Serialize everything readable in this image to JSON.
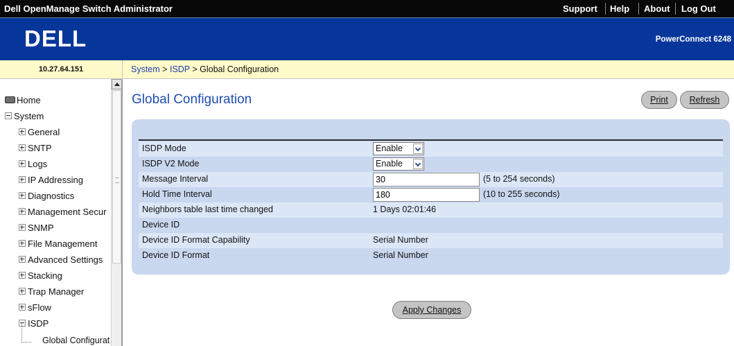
{
  "header": {
    "app_title": "Dell OpenManage Switch Administrator",
    "links": [
      "Support",
      "Help",
      "About",
      "Log Out"
    ],
    "logo_text": "DELL",
    "product": "PowerConnect 6248"
  },
  "ip_address": "10.27.64.151",
  "breadcrumb": {
    "system": "System",
    "sep1": " > ",
    "isdp": "ISDP",
    "sep2": " > ",
    "current": "Global Configuration"
  },
  "sidebar": {
    "home": "Home",
    "system": "System",
    "items": [
      "General",
      "SNTP",
      "Logs",
      "IP Addressing",
      "Diagnostics",
      "Management Secur",
      "SNMP",
      "File Management",
      "Advanced Settings",
      "Stacking",
      "Trap Manager",
      "sFlow",
      "ISDP"
    ],
    "selected_child": "Global Configurat"
  },
  "main": {
    "title": "Global Configuration",
    "print_label": "Print",
    "refresh_label": "Refresh",
    "apply_label": "Apply Changes",
    "rows": {
      "isdp_mode": {
        "label": "ISDP Mode",
        "value": "Enable"
      },
      "isdp_v2_mode": {
        "label": "ISDP V2 Mode",
        "value": "Enable"
      },
      "message_interval": {
        "label": "Message Interval",
        "value": "30",
        "hint": "(5 to 254 seconds)"
      },
      "hold_time": {
        "label": "Hold Time Interval",
        "value": "180",
        "hint": "(10 to 255 seconds)"
      },
      "neighbors_changed": {
        "label": "Neighbors table last time changed",
        "value": "1 Days 02:01:46"
      },
      "device_id": {
        "label": "Device ID",
        "value": ""
      },
      "device_id_cap": {
        "label": "Device ID Format Capability",
        "value": "Serial Number"
      },
      "device_id_format": {
        "label": "Device ID Format",
        "value": "Serial Number"
      }
    }
  },
  "colors": {
    "brand_blue": "#07369b",
    "title_blue": "#1f4db0",
    "panel_bg": "#c9d7ef",
    "crumb_bg": "#fffac9"
  }
}
